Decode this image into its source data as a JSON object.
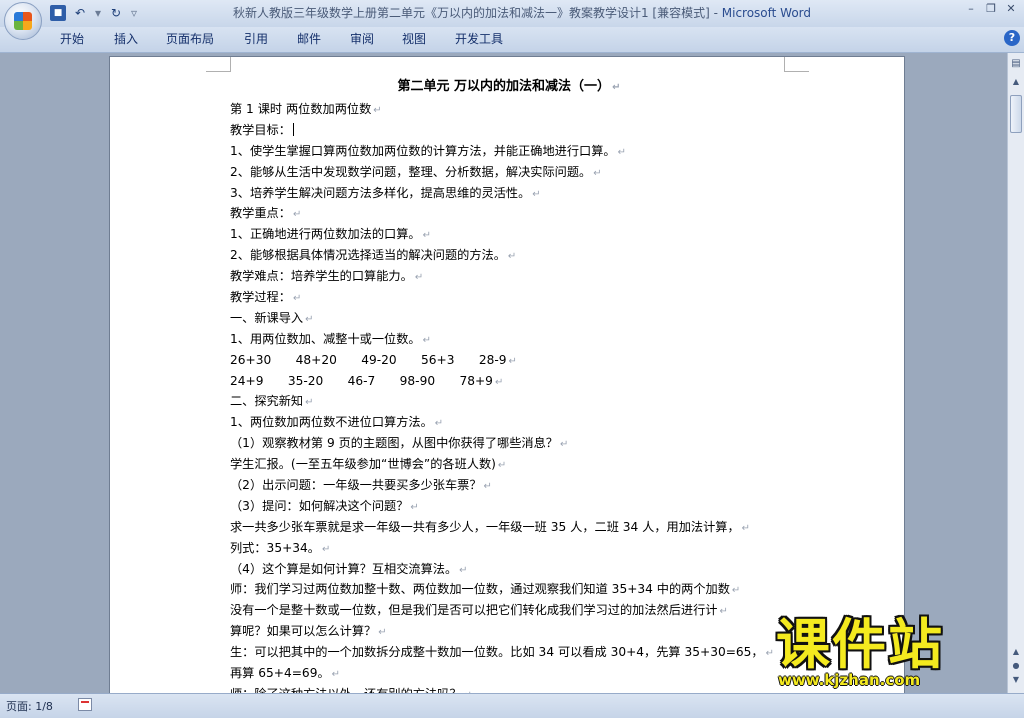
{
  "window": {
    "title": "秋新人教版三年级数学上册第二单元《万以内的加法和减法一》教案教学设计1 [兼容模式] - ",
    "app_name": "Microsoft Word",
    "controls": {
      "minimize": "–",
      "restore": "❐",
      "close": "✕"
    }
  },
  "quick_access": {
    "save_icon": "save-icon",
    "undo_icon": "undo-icon",
    "redo_icon": "redo-icon"
  },
  "ribbon": {
    "tabs": [
      "开始",
      "插入",
      "页面布局",
      "引用",
      "邮件",
      "审阅",
      "视图",
      "开发工具"
    ],
    "help_label": "?"
  },
  "document": {
    "lines": [
      "第二单元 万以内的加法和减法（一）",
      "第 1 课时 两位数加两位数",
      "教学目标：",
      "1、使学生掌握口算两位数加两位数的计算方法，并能正确地进行口算。",
      "2、能够从生活中发现数学问题，整理、分析数据，解决实际问题。",
      "3、培养学生解决问题方法多样化，提高思维的灵活性。",
      "教学重点：",
      "1、正确地进行两位数加法的口算。",
      "2、能够根据具体情况选择适当的解决问题的方法。",
      "教学难点：培养学生的口算能力。",
      "教学过程：",
      "一、新课导入",
      "1、用两位数加、减整十或一位数。",
      "26+30　　48+20　　49-20　　56+3　　28-9",
      "24+9　　35-20　　46-7　　98-90　　78+9",
      " 二、探究新知",
      "1、两位数加两位数不进位口算方法。",
      "（1）观察教材第 9 页的主题图，从图中你获得了哪些消息？",
      "学生汇报。(一至五年级参加“世博会”的各班人数)",
      "（2）出示问题：一年级一共要买多少张车票？",
      "（3）提问：如何解决这个问题？",
      "求一共多少张车票就是求一年级一共有多少人，一年级一班 35 人，二班 34 人，用加法计算，",
      "列式：35+34。",
      "（4）这个算是如何计算？互相交流算法。",
      "师：我们学习过两位数加整十数、两位数加一位数，通过观察我们知道 35+34 中的两个加数",
      "没有一个是整十数或一位数，但是我们是否可以把它们转化成我们学习过的加法然后进行计",
      "算呢？如果可以怎么计算？",
      "生：可以把其中的一个加数拆分成整十数加一位数。比如 34 可以看成 30+4，先算 35+30=65，",
      "再算 65+4=69。",
      "师：除了这种方法以外，还有别的方法吗？"
    ]
  },
  "status": {
    "page_info": "页面: 1/8"
  },
  "watermark": {
    "brand": "课件站",
    "url": "www.kjzhan.com"
  }
}
